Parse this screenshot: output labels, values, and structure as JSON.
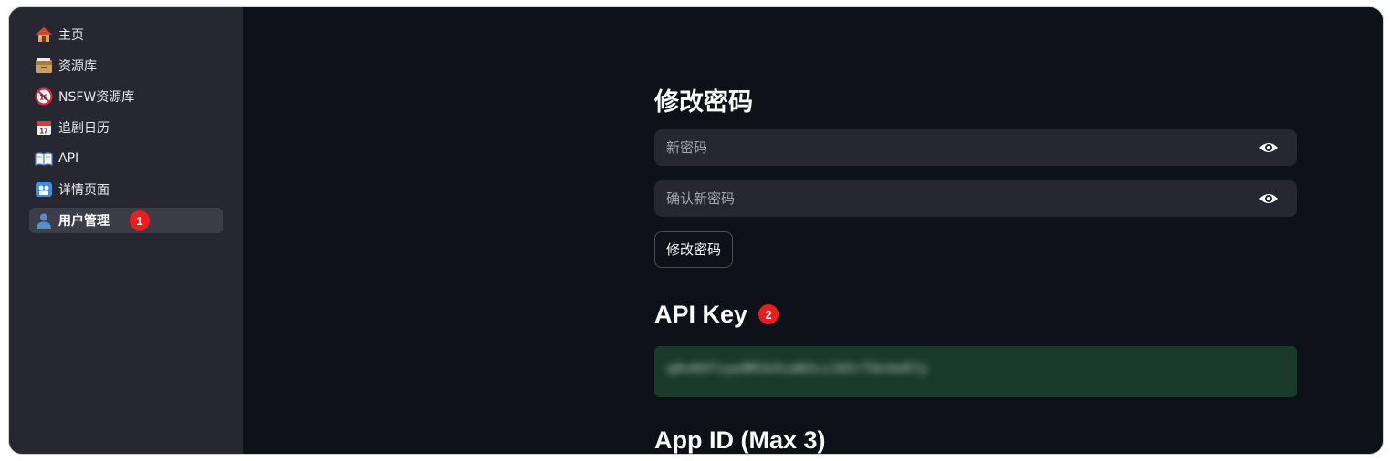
{
  "sidebar": {
    "items": [
      {
        "label": "主页",
        "icon": "house-icon"
      },
      {
        "label": "资源库",
        "icon": "card-file-box-icon"
      },
      {
        "label": "NSFW资源库",
        "icon": "no-one-under-18-icon"
      },
      {
        "label": "追剧日历",
        "icon": "calendar-icon"
      },
      {
        "label": "API",
        "icon": "open-book-icon"
      },
      {
        "label": "详情页面",
        "icon": "film-frames-icon"
      },
      {
        "label": "用户管理",
        "icon": "user-icon",
        "active": true,
        "badge": "1"
      }
    ]
  },
  "main": {
    "change_password": {
      "title": "修改密码",
      "new_password_placeholder": "新密码",
      "confirm_password_placeholder": "确认新密码",
      "submit_label": "修改密码"
    },
    "api_key": {
      "title": "API Key",
      "badge": "2",
      "value": "q8vKHfzyw9M1kXsaN3czJA5rT6nXeR7y"
    },
    "app_id": {
      "title": "App ID (Max 3)"
    }
  },
  "colors": {
    "background": "#0e1117",
    "sidebar": "#262730",
    "input": "#262730",
    "success_box": "#1a3a29",
    "badge": "#ee1c1c"
  }
}
